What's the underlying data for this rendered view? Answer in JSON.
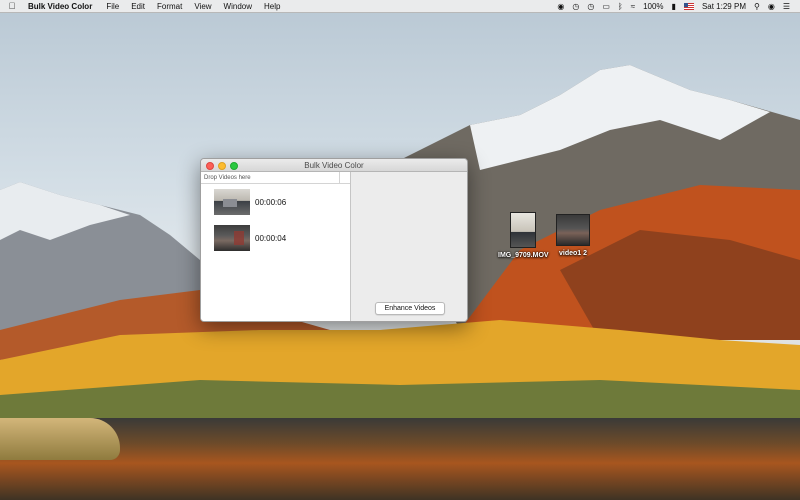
{
  "menubar": {
    "app_name": "Bulk Video Color",
    "menus": [
      "File",
      "Edit",
      "Format",
      "View",
      "Window",
      "Help"
    ],
    "battery": "100%",
    "clock": "Sat 1:29 PM",
    "status_icons": [
      "creative-cloud-icon",
      "timer-icon",
      "clock-icon",
      "airplay-icon",
      "bluetooth-icon",
      "wifi-icon",
      "battery-icon",
      "us-flag-icon",
      "search-icon",
      "siri-icon",
      "menu-icon"
    ]
  },
  "window": {
    "title": "Bulk Video Color",
    "column_header": "Drop Videos here",
    "videos": [
      {
        "duration": "00:00:06"
      },
      {
        "duration": "00:00:04"
      }
    ],
    "enhance_label": "Enhance Videos"
  },
  "desktop": {
    "files": [
      {
        "label": "IMG_9709.MOV"
      },
      {
        "label": "video1 2"
      }
    ]
  },
  "colors": {
    "close": "#fc5f57",
    "minimize": "#fdbc2f",
    "zoom": "#29c840"
  }
}
